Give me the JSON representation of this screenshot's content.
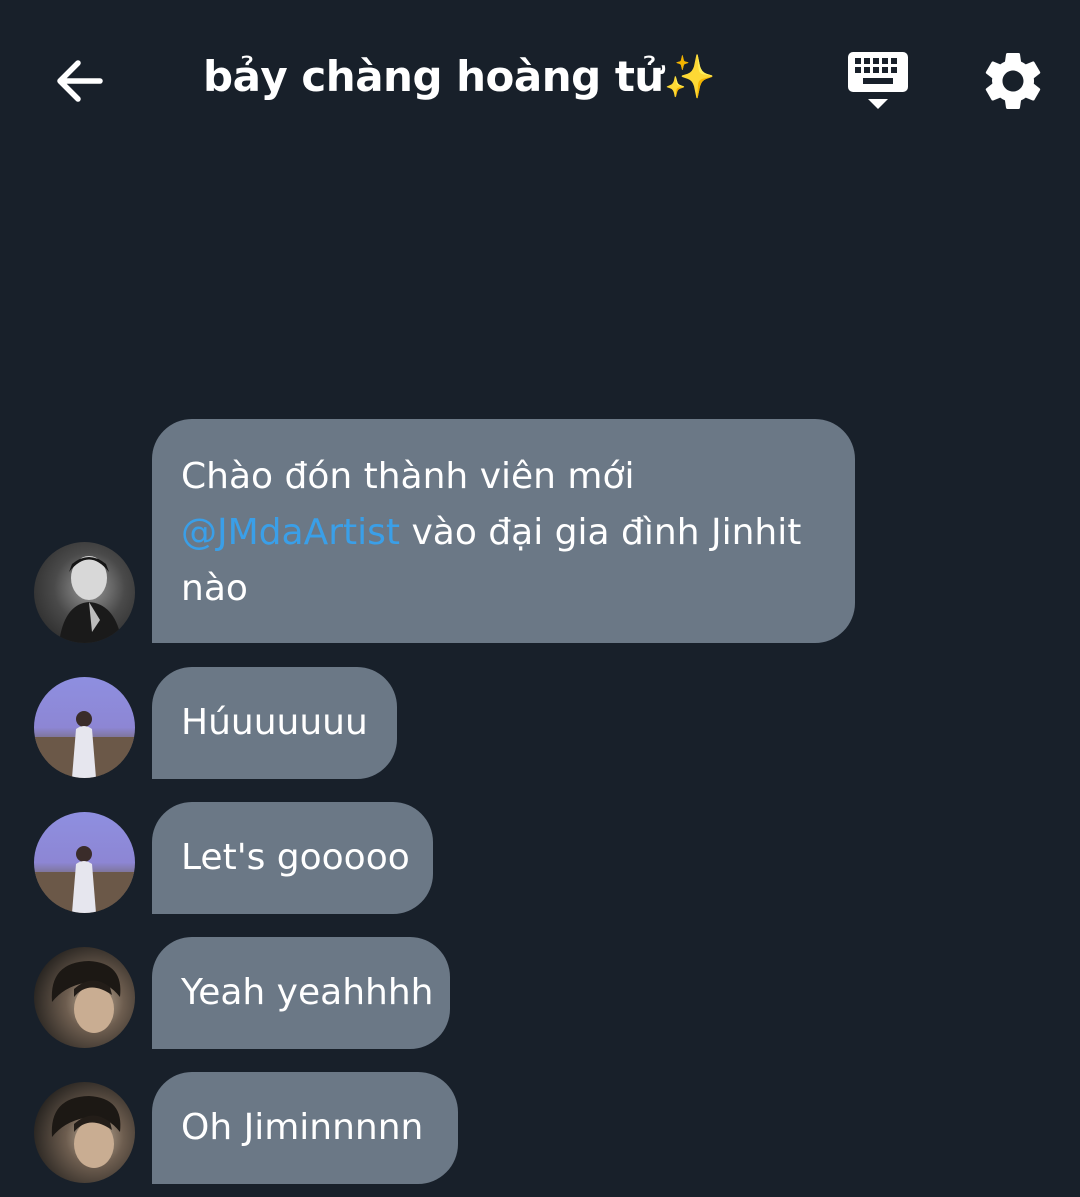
{
  "header": {
    "title": "bảy chàng hoàng tử✨",
    "back_icon": "arrow-left-icon",
    "keyboard_icon": "keyboard-hide-icon",
    "settings_icon": "gear-icon"
  },
  "messages": [
    {
      "avatar": "profile photo black-and-white",
      "lines": [
        "Chào đón thành viên mới",
        "vào đại gia đình Jinhit",
        "nào"
      ],
      "mention": "@JMdaArtist"
    },
    {
      "avatar": "profile photo purple sky",
      "text": "Húuuuuuu"
    },
    {
      "avatar": "profile photo purple sky",
      "text": "Let's gooooo"
    },
    {
      "avatar": "profile photo curly hair",
      "text": "Yeah yeahhhh"
    },
    {
      "avatar": "profile photo curly hair",
      "text": "Oh Jiminnnnn"
    }
  ],
  "colors": {
    "background": "#18202a",
    "bubble": "#6b7886",
    "mention": "#3a9fe8",
    "text": "#ffffff"
  }
}
